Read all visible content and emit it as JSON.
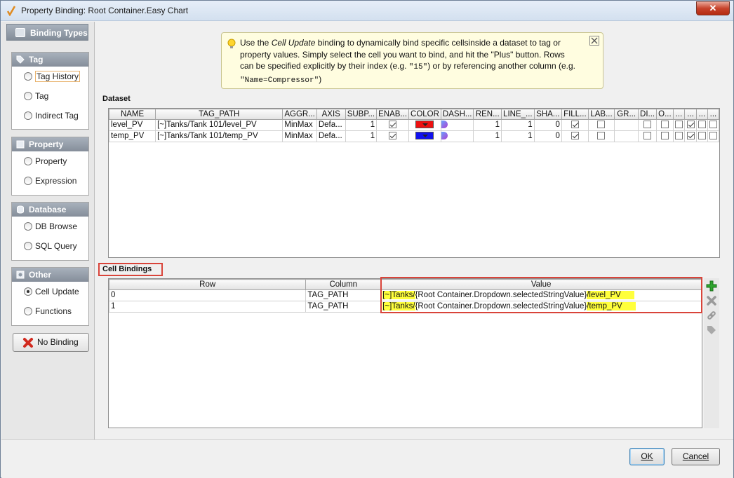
{
  "window": {
    "title": "Property Binding: Root Container.Easy Chart",
    "close_label": "✕"
  },
  "binding_types": {
    "header": "Binding Types",
    "groups": [
      {
        "name": "Tag",
        "options": [
          "Tag History",
          "Tag",
          "Indirect Tag"
        ]
      },
      {
        "name": "Property",
        "options": [
          "Property",
          "Expression"
        ]
      },
      {
        "name": "Database",
        "options": [
          "DB Browse",
          "SQL Query"
        ]
      },
      {
        "name": "Other",
        "options": [
          "Cell Update",
          "Functions"
        ]
      }
    ],
    "selected": "Cell Update",
    "focused": "Tag History",
    "no_binding_label": "No Binding"
  },
  "tip": {
    "line1_pre": "Use the ",
    "line1_em": "Cell Update",
    "line1_post": " binding to dynamically bind specific cellsinside a dataset to tag or",
    "line2": "property values. Simply select the cell you want to bind, and hit the \"Plus\" button. Rows",
    "line3": "can be specified explicitly by their index (e.g. ",
    "line3_code": "\"15\"",
    "line3_post": ") or by referencing another column (e.g.",
    "line4_code": "\"Name=Compressor\"",
    "line4_post": ")"
  },
  "dataset": {
    "label": "Dataset",
    "columns": [
      "NAME",
      "TAG_PATH",
      "AGGR...",
      "AXIS",
      "SUBP...",
      "ENAB...",
      "COLOR",
      "DASH...",
      "REN...",
      "LINE_...",
      "SHA...",
      "FILL...",
      "LAB...",
      "GR...",
      "DI...",
      "O...",
      "...",
      "...",
      "...",
      "..."
    ],
    "rows": [
      {
        "name": "level_PV",
        "tag_path": "[~]Tanks/Tank 101/level_PV",
        "aggr": "MinMax",
        "axis": "Defa...",
        "subp": "1",
        "enab": true,
        "color": "#ee1111",
        "ren": "1",
        "line": "1",
        "sha": "0",
        "fill": true,
        "lab": false,
        "di": false,
        "o": false,
        "c1": false,
        "c2": true,
        "c3": false
      },
      {
        "name": "temp_PV",
        "tag_path": "[~]Tanks/Tank 101/temp_PV",
        "aggr": "MinMax",
        "axis": "Defa...",
        "subp": "1",
        "enab": true,
        "color": "#1111ee",
        "ren": "1",
        "line": "1",
        "sha": "0",
        "fill": true,
        "lab": false,
        "di": false,
        "o": false,
        "c1": false,
        "c2": true,
        "c3": false
      }
    ]
  },
  "cell_bindings": {
    "label": "Cell Bindings",
    "columns": [
      "Row",
      "Column",
      "Value"
    ],
    "rows": [
      {
        "row": "0",
        "column": "TAG_PATH",
        "value_pre": "[~]Tanks/",
        "value_mid": "{Root Container.Dropdown.selectedStringValue}",
        "value_post": "/level_PV"
      },
      {
        "row": "1",
        "column": "TAG_PATH",
        "value_pre": "[~]Tanks/",
        "value_mid": "{Root Container.Dropdown.selectedStringValue}",
        "value_post": "/temp_PV"
      }
    ]
  },
  "tools": [
    "add-icon",
    "delete-icon",
    "link-icon",
    "tag-icon"
  ],
  "buttons": {
    "ok": "OK",
    "cancel": "Cancel"
  },
  "colors": {
    "highlight": "#ffff3c",
    "redbox": "#d9443a",
    "header_gray": "#8f99a5"
  }
}
